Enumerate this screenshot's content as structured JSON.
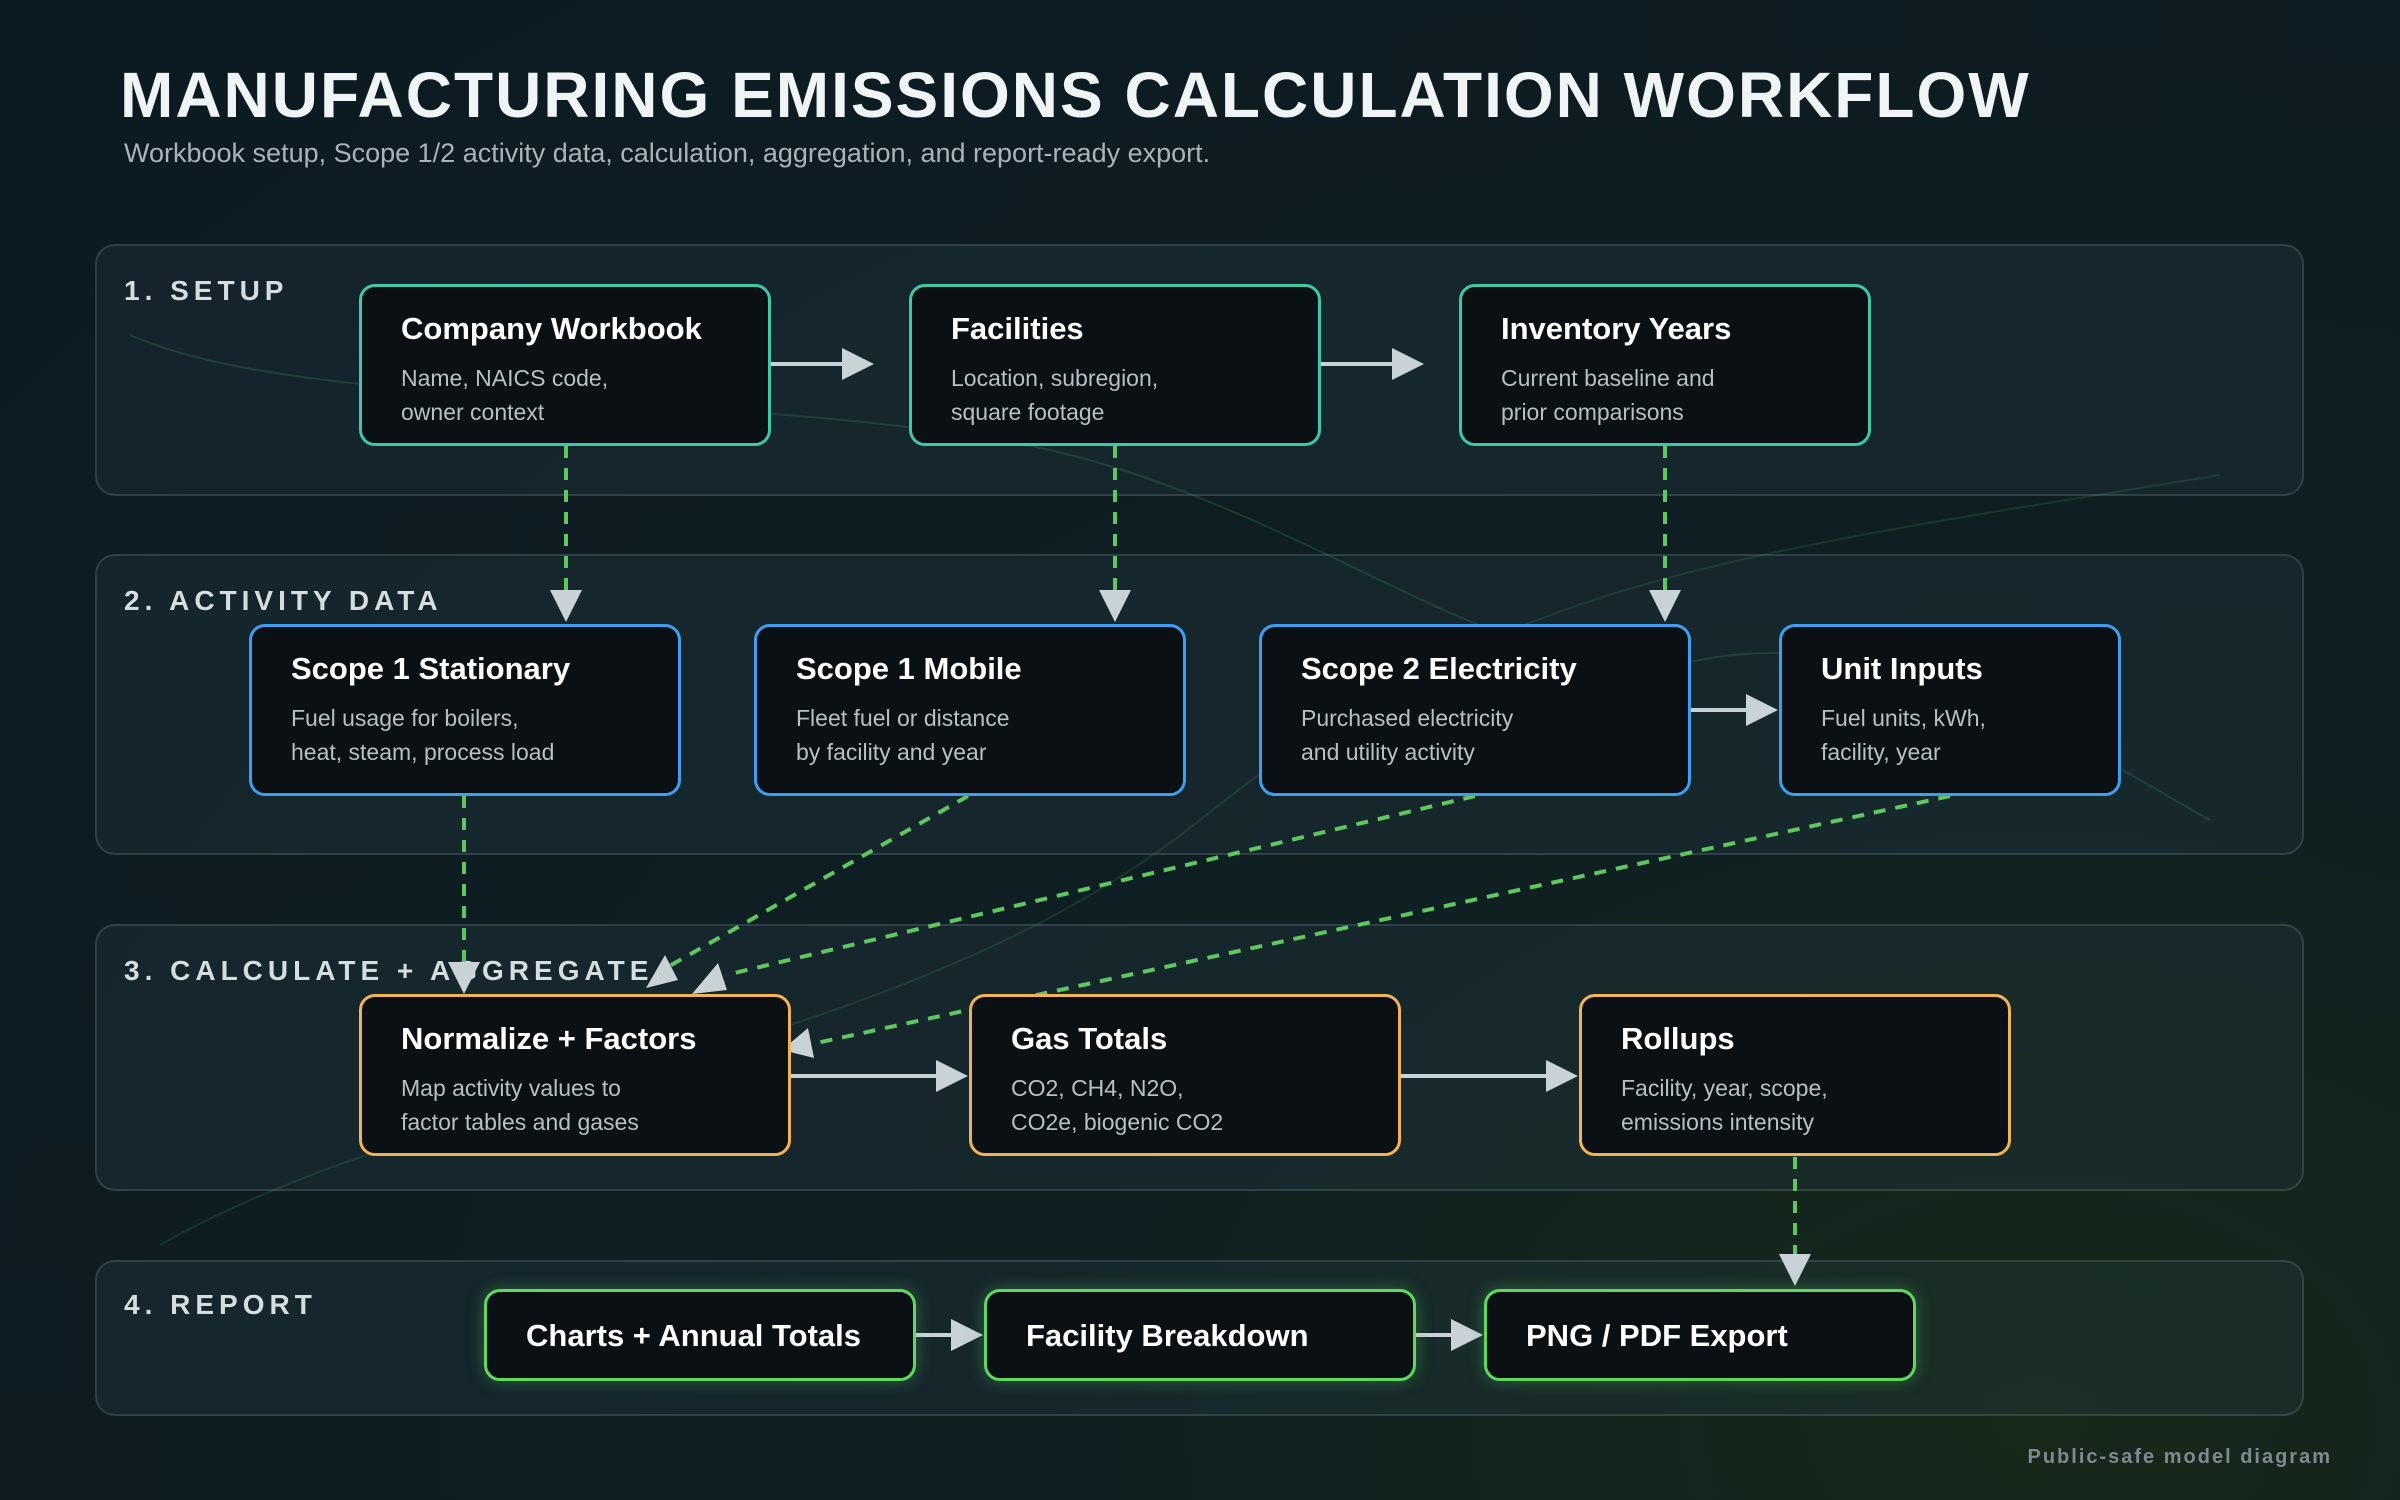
{
  "header": {
    "title": "MANUFACTURING EMISSIONS CALCULATION WORKFLOW",
    "subtitle": "Workbook setup, Scope 1/2 activity data, calculation, aggregation, and report-ready export."
  },
  "sections": {
    "setup": {
      "label": "1. SETUP"
    },
    "activity": {
      "label": "2. ACTIVITY DATA"
    },
    "calculate": {
      "label": "3. CALCULATE + AGGREGATE"
    },
    "report": {
      "label": "4. REPORT"
    }
  },
  "nodes": {
    "company_workbook": {
      "title": "Company Workbook",
      "desc": [
        "Name, NAICS code,",
        "owner context"
      ]
    },
    "facilities": {
      "title": "Facilities",
      "desc": [
        "Location, subregion,",
        "square footage"
      ]
    },
    "inventory_years": {
      "title": "Inventory Years",
      "desc": [
        "Current baseline and",
        "prior comparisons"
      ]
    },
    "scope1_stationary": {
      "title": "Scope 1 Stationary",
      "desc": [
        "Fuel usage for boilers,",
        "heat, steam, process load"
      ]
    },
    "scope1_mobile": {
      "title": "Scope 1 Mobile",
      "desc": [
        "Fleet fuel or distance",
        "by facility and year"
      ]
    },
    "scope2_electricity": {
      "title": "Scope 2 Electricity",
      "desc": [
        "Purchased electricity",
        "and utility activity"
      ]
    },
    "unit_inputs": {
      "title": "Unit Inputs",
      "desc": [
        "Fuel units, kWh,",
        "facility, year"
      ]
    },
    "normalize_factors": {
      "title": "Normalize + Factors",
      "desc": [
        "Map activity values to",
        "factor tables and gases"
      ]
    },
    "gas_totals": {
      "title": "Gas Totals",
      "desc": [
        "CO2, CH4, N2O,",
        "CO2e, biogenic CO2"
      ]
    },
    "rollups": {
      "title": "Rollups",
      "desc": [
        "Facility, year, scope,",
        "emissions intensity"
      ]
    },
    "charts_totals": {
      "title": "Charts + Annual Totals"
    },
    "facility_breakdown": {
      "title": "Facility Breakdown"
    },
    "png_pdf_export": {
      "title": "PNG / PDF Export"
    }
  },
  "colors": {
    "setup_border": "#3ec8a8",
    "activity_border": "#3f9ef0",
    "calculate_border": "#f2b357",
    "report_border": "#5fd85e",
    "solid_arrow": "#c9d2d6",
    "dashed_arrow": "#5fc760"
  },
  "footer": {
    "note": "Public-safe model diagram"
  }
}
